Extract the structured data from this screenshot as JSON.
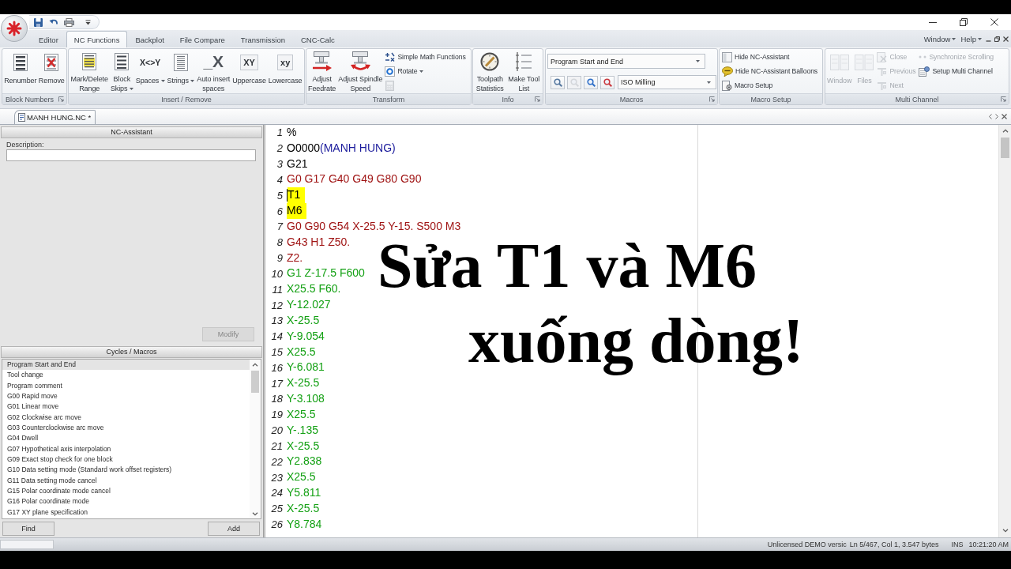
{
  "ribbon": {
    "tabs": [
      {
        "label": "Editor",
        "selected": false
      },
      {
        "label": "NC Functions",
        "selected": true
      },
      {
        "label": "Backplot",
        "selected": false
      },
      {
        "label": "File Compare",
        "selected": false
      },
      {
        "label": "Transmission",
        "selected": false
      },
      {
        "label": "CNC-Calc",
        "selected": false
      }
    ],
    "menus": [
      {
        "label": "Window"
      },
      {
        "label": "Help"
      }
    ],
    "groups": [
      {
        "label": "Block Numbers",
        "launcher": true,
        "items": [
          {
            "kind": "large",
            "label": "Renumber",
            "disabled": false,
            "dropdown": false
          },
          {
            "kind": "large",
            "label": "Remove",
            "disabled": false,
            "dropdown": false
          }
        ]
      },
      {
        "label": "Insert / Remove",
        "launcher": false,
        "items": [
          {
            "kind": "large",
            "label": "Mark/Delete\nRange",
            "disabled": false,
            "dropdown": false
          },
          {
            "kind": "large",
            "label": "Block\nSkips",
            "disabled": false,
            "dropdown": true
          },
          {
            "kind": "large",
            "label": "Spaces",
            "glyph": "X<>Y",
            "disabled": false,
            "dropdown": true
          },
          {
            "kind": "large",
            "label": "Strings",
            "disabled": false,
            "dropdown": true
          },
          {
            "kind": "large",
            "label": "Auto insert\nspaces",
            "glyph": "_X",
            "disabled": false,
            "dropdown": false
          },
          {
            "kind": "large",
            "label": "Uppercase",
            "glyph": "XY",
            "disabled": false,
            "dropdown": false
          },
          {
            "kind": "large",
            "label": "Lowercase",
            "glyph": "xy",
            "disabled": false,
            "dropdown": false
          }
        ]
      },
      {
        "label": "Transform",
        "launcher": false,
        "items": [
          {
            "kind": "large",
            "label": "Adjust\nFeedrate",
            "disabled": false,
            "dropdown": false
          },
          {
            "kind": "large",
            "label": "Adjust Spindle\nSpeed",
            "disabled": false,
            "dropdown": false
          },
          {
            "kind": "stack",
            "items": [
              {
                "label": "Simple Math Functions",
                "disabled": false,
                "dropdown": false
              },
              {
                "label": "Rotate",
                "disabled": false,
                "dropdown": true
              },
              {
                "disabled": true,
                "dropdown": false
              }
            ]
          }
        ]
      },
      {
        "label": "Info",
        "launcher": true,
        "items": [
          {
            "kind": "large",
            "label": "Toolpath\nStatistics",
            "disabled": false,
            "dropdown": false
          },
          {
            "kind": "large",
            "label": "Make Tool\nList",
            "disabled": false,
            "dropdown": false
          }
        ]
      },
      {
        "label": "Macros",
        "launcher": true,
        "items": [
          {
            "kind": "macro_panel",
            "macro_select": {
              "value": "Program Start and End"
            },
            "tools": [
              {
                "disabled": false
              },
              {
                "disabled": true
              },
              {
                "disabled": false
              },
              {
                "disabled": false
              }
            ],
            "control_select": {
              "value": "ISO Milling"
            }
          }
        ]
      },
      {
        "label": "Macro Setup",
        "launcher": false,
        "items": [
          {
            "kind": "stack",
            "items": [
              {
                "label": "Hide NC-Assistant",
                "disabled": false,
                "dropdown": false
              },
              {
                "label": "Hide NC-Assistant Balloons",
                "disabled": false,
                "dropdown": false
              },
              {
                "label": "Macro Setup",
                "disabled": false,
                "dropdown": false
              }
            ]
          }
        ]
      },
      {
        "label": "Multi Channel",
        "launcher": true,
        "items": [
          {
            "kind": "large",
            "label": "Window",
            "disabled": true,
            "dropdown": false
          },
          {
            "kind": "large",
            "label": "Files",
            "disabled": true,
            "dropdown": false
          },
          {
            "kind": "stack",
            "items": [
              {
                "label": "Close",
                "disabled": true,
                "dropdown": false
              },
              {
                "label": "Previous",
                "disabled": true,
                "dropdown": false
              },
              {
                "label": "Next",
                "disabled": true,
                "dropdown": false
              }
            ]
          },
          {
            "kind": "stack",
            "items": [
              {
                "label": "Synchronize Scrolling",
                "disabled": true,
                "dropdown": false
              },
              {
                "label": "Setup Multi Channel",
                "disabled": false,
                "dropdown": false
              }
            ]
          }
        ]
      }
    ]
  },
  "documents": [
    {
      "label": "MANH HUNG.NC *",
      "selected": true
    }
  ],
  "nc_assistant": {
    "title": "NC-Assistant",
    "description": {
      "label": "Description:"
    },
    "modify_button": {
      "label": "Modify",
      "disabled": true
    }
  },
  "cycles": {
    "title": "Cycles / Macros",
    "items": [
      {
        "label": "Program Start and End",
        "selected": true
      },
      {
        "label": "Tool change",
        "selected": false
      },
      {
        "label": "Program comment",
        "selected": false
      },
      {
        "label": "G00 Rapid move",
        "selected": false
      },
      {
        "label": "G01 Linear move",
        "selected": false
      },
      {
        "label": "G02 Clockwise arc move",
        "selected": false
      },
      {
        "label": "G03 Counterclockwise arc move",
        "selected": false
      },
      {
        "label": "G04 Dwell",
        "selected": false
      },
      {
        "label": "G07 Hypothetical axis interpolation",
        "selected": false
      },
      {
        "label": "G09 Exact stop check for one block",
        "selected": false
      },
      {
        "label": "G10 Data setting mode (Standard work offset registers)",
        "selected": false
      },
      {
        "label": "G11 Data setting mode cancel",
        "selected": false
      },
      {
        "label": "G15 Polar coordinate mode cancel",
        "selected": false
      },
      {
        "label": "G16 Polar coordinate mode",
        "selected": false
      },
      {
        "label": "G17 XY plane specification",
        "selected": false
      }
    ],
    "buttons": [
      {
        "label": "Find"
      },
      {
        "label": "Add"
      }
    ]
  },
  "editor": {
    "lines": [
      {
        "number": "1",
        "segments": [
          {
            "kind": "plain",
            "text": "%"
          }
        ],
        "highlighted": false,
        "caret": false
      },
      {
        "number": "2",
        "segments": [
          {
            "kind": "plain",
            "text": "O0000"
          },
          {
            "kind": "comment",
            "text": "(MANH HUNG)"
          }
        ],
        "highlighted": false,
        "caret": false
      },
      {
        "number": "3",
        "segments": [
          {
            "kind": "plain",
            "text": "G21"
          }
        ],
        "highlighted": false,
        "caret": false
      },
      {
        "number": "4",
        "segments": [
          {
            "kind": "rapid",
            "text": "G0 G17 G40 G49 G80 G90"
          }
        ],
        "highlighted": false,
        "caret": false
      },
      {
        "number": "5",
        "segments": [
          {
            "kind": "plain",
            "text": "T1"
          }
        ],
        "highlighted": true,
        "caret": true
      },
      {
        "number": "6",
        "segments": [
          {
            "kind": "plain",
            "text": "M6"
          }
        ],
        "highlighted": true,
        "caret": false
      },
      {
        "number": "7",
        "segments": [
          {
            "kind": "rapid",
            "text": "G0 G90 G54 X-25.5 Y-15. S500 M3"
          }
        ],
        "highlighted": false,
        "caret": false
      },
      {
        "number": "8",
        "segments": [
          {
            "kind": "rapid",
            "text": "G43 H1 Z50."
          }
        ],
        "highlighted": false,
        "caret": false
      },
      {
        "number": "9",
        "segments": [
          {
            "kind": "rapid",
            "text": "Z2."
          }
        ],
        "highlighted": false,
        "caret": false
      },
      {
        "number": "10",
        "segments": [
          {
            "kind": "feed",
            "text": "G1 Z-17.5 F600"
          }
        ],
        "highlighted": false,
        "caret": false
      },
      {
        "number": "11",
        "segments": [
          {
            "kind": "feed",
            "text": "X25.5 F60."
          }
        ],
        "highlighted": false,
        "caret": false
      },
      {
        "number": "12",
        "segments": [
          {
            "kind": "feed",
            "text": "Y-12.027"
          }
        ],
        "highlighted": false,
        "caret": false
      },
      {
        "number": "13",
        "segments": [
          {
            "kind": "feed",
            "text": "X-25.5"
          }
        ],
        "highlighted": false,
        "caret": false
      },
      {
        "number": "14",
        "segments": [
          {
            "kind": "feed",
            "text": "Y-9.054"
          }
        ],
        "highlighted": false,
        "caret": false
      },
      {
        "number": "15",
        "segments": [
          {
            "kind": "feed",
            "text": "X25.5"
          }
        ],
        "highlighted": false,
        "caret": false
      },
      {
        "number": "16",
        "segments": [
          {
            "kind": "feed",
            "text": "Y-6.081"
          }
        ],
        "highlighted": false,
        "caret": false
      },
      {
        "number": "17",
        "segments": [
          {
            "kind": "feed",
            "text": "X-25.5"
          }
        ],
        "highlighted": false,
        "caret": false
      },
      {
        "number": "18",
        "segments": [
          {
            "kind": "feed",
            "text": "Y-3.108"
          }
        ],
        "highlighted": false,
        "caret": false
      },
      {
        "number": "19",
        "segments": [
          {
            "kind": "feed",
            "text": "X25.5"
          }
        ],
        "highlighted": false,
        "caret": false
      },
      {
        "number": "20",
        "segments": [
          {
            "kind": "feed",
            "text": "Y-.135"
          }
        ],
        "highlighted": false,
        "caret": false
      },
      {
        "number": "21",
        "segments": [
          {
            "kind": "feed",
            "text": "X-25.5"
          }
        ],
        "highlighted": false,
        "caret": false
      },
      {
        "number": "22",
        "segments": [
          {
            "kind": "feed",
            "text": "Y2.838"
          }
        ],
        "highlighted": false,
        "caret": false
      },
      {
        "number": "23",
        "segments": [
          {
            "kind": "feed",
            "text": "X25.5"
          }
        ],
        "highlighted": false,
        "caret": false
      },
      {
        "number": "24",
        "segments": [
          {
            "kind": "feed",
            "text": "Y5.811"
          }
        ],
        "highlighted": false,
        "caret": false
      },
      {
        "number": "25",
        "segments": [
          {
            "kind": "feed",
            "text": "X-25.5"
          }
        ],
        "highlighted": false,
        "caret": false
      },
      {
        "number": "26",
        "segments": [
          {
            "kind": "feed",
            "text": "Y8.784"
          }
        ],
        "highlighted": false,
        "caret": false
      }
    ]
  },
  "caption": {
    "lines": [
      "Sửa T1 và M6",
      "xuống dòng!"
    ]
  },
  "status_bar": {
    "fields": [
      "Unlicensed DEMO versic",
      "Ln 5/467, Col 1, 3.547 bytes",
      "INS",
      "10:21:20 AM"
    ]
  }
}
